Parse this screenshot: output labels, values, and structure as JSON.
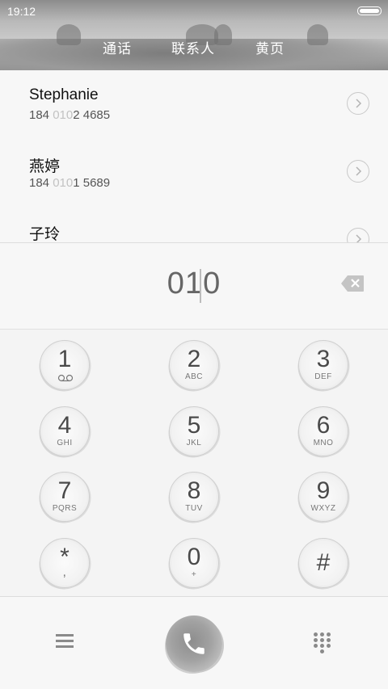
{
  "status": {
    "time": "19:12"
  },
  "tabs": [
    {
      "label": "通话"
    },
    {
      "label": "联系人"
    },
    {
      "label": "黄页"
    }
  ],
  "suggestions": [
    {
      "name": "Stephanie",
      "number_pre": "184 ",
      "number_match": "010",
      "number_post": "2 4685"
    },
    {
      "name": "燕婷",
      "number_pre": "184 ",
      "number_match": "010",
      "number_post": "1 5689"
    },
    {
      "name": "子玲",
      "number_pre": "",
      "number_match": "",
      "number_post": ""
    }
  ],
  "dialer": {
    "input": "010"
  },
  "keypad": [
    {
      "digit": "1",
      "letters": ""
    },
    {
      "digit": "2",
      "letters": "ABC"
    },
    {
      "digit": "3",
      "letters": "DEF"
    },
    {
      "digit": "4",
      "letters": "GHI"
    },
    {
      "digit": "5",
      "letters": "JKL"
    },
    {
      "digit": "6",
      "letters": "MNO"
    },
    {
      "digit": "7",
      "letters": "PQRS"
    },
    {
      "digit": "8",
      "letters": "TUV"
    },
    {
      "digit": "9",
      "letters": "WXYZ"
    },
    {
      "digit": "*",
      "letters": ","
    },
    {
      "digit": "0",
      "letters": "+"
    },
    {
      "digit": "#",
      "letters": ""
    }
  ],
  "icons": {
    "battery": "battery-icon",
    "backspace": "backspace-icon",
    "voicemail": "voicemail-icon",
    "menu": "menu-icon",
    "call": "phone-icon",
    "dialpad": "dialpad-icon",
    "detail": "chevron-right-icon"
  }
}
